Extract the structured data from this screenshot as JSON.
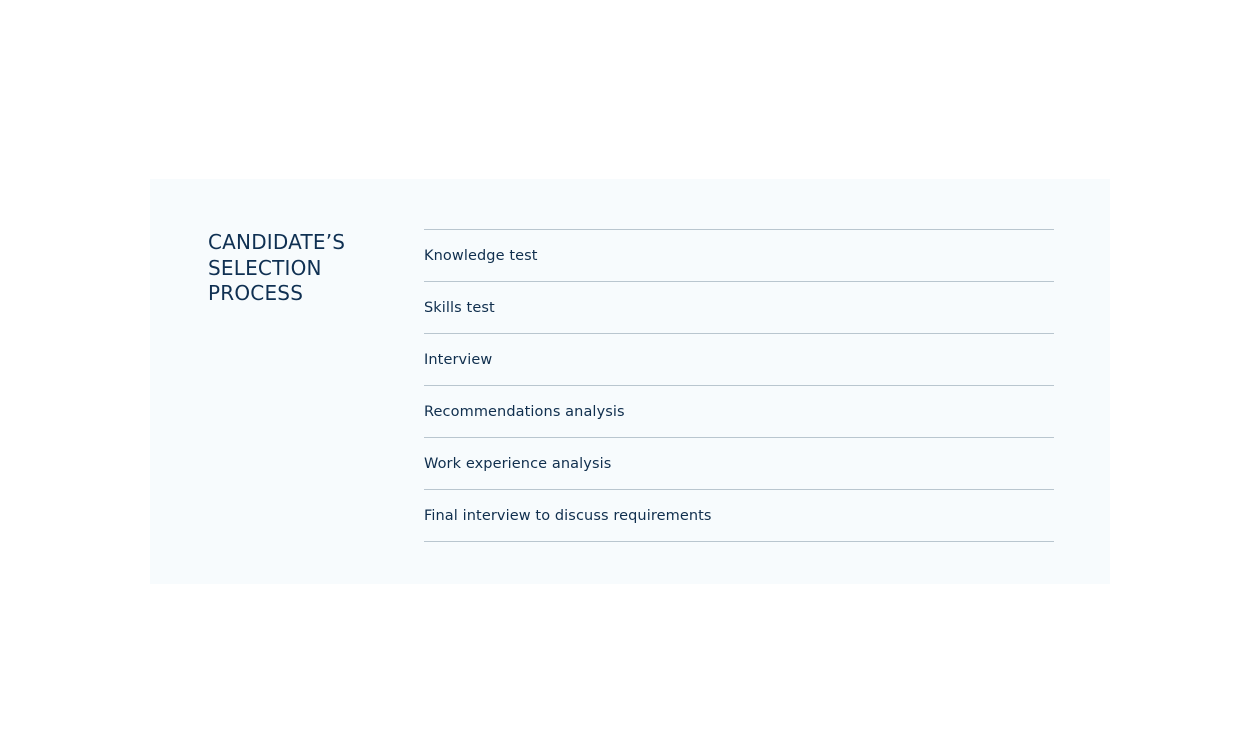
{
  "section": {
    "title_lines": [
      "CANDIDATE’S",
      "SELECTION",
      "PROCESS"
    ],
    "steps": [
      "Knowledge test",
      "Skills test",
      "Interview",
      "Recommendations analysis",
      "Work experience analysis",
      "Final interview to discuss requirements"
    ]
  },
  "colors": {
    "card_background": "#f7fbfd",
    "text": "#0e2f4f",
    "divider": "#b9c6cf"
  }
}
